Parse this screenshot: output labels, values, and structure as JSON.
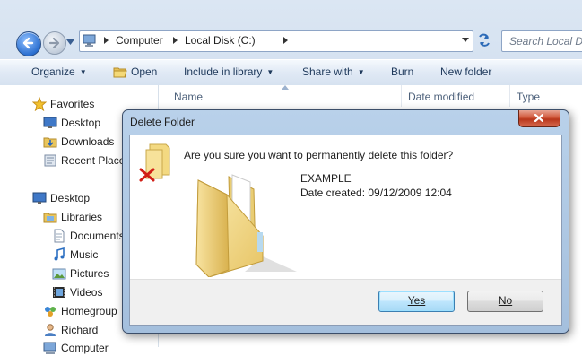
{
  "address": {
    "crumbs": [
      "Computer",
      "Local Disk (C:)"
    ],
    "search_placeholder": "Search Local Disk"
  },
  "toolbar": {
    "organize": "Organize",
    "open": "Open",
    "include": "Include in library",
    "share": "Share with",
    "burn": "Burn",
    "new_folder": "New folder"
  },
  "nav": {
    "favorites": "Favorites",
    "desktop_fav": "Desktop",
    "downloads": "Downloads",
    "recent": "Recent Places",
    "desktop": "Desktop",
    "libraries": "Libraries",
    "documents": "Documents",
    "music": "Music",
    "pictures": "Pictures",
    "videos": "Videos",
    "homegroup": "Homegroup",
    "richard": "Richard",
    "computer": "Computer"
  },
  "columns": {
    "name": "Name",
    "date_modified": "Date modified",
    "type": "Type"
  },
  "dialog": {
    "title": "Delete Folder",
    "question": "Are you sure you want to permanently delete this folder?",
    "folder_name": "EXAMPLE",
    "date_created": "Date created: 09/12/2009 12:04",
    "yes": "Yes",
    "no": "No"
  }
}
